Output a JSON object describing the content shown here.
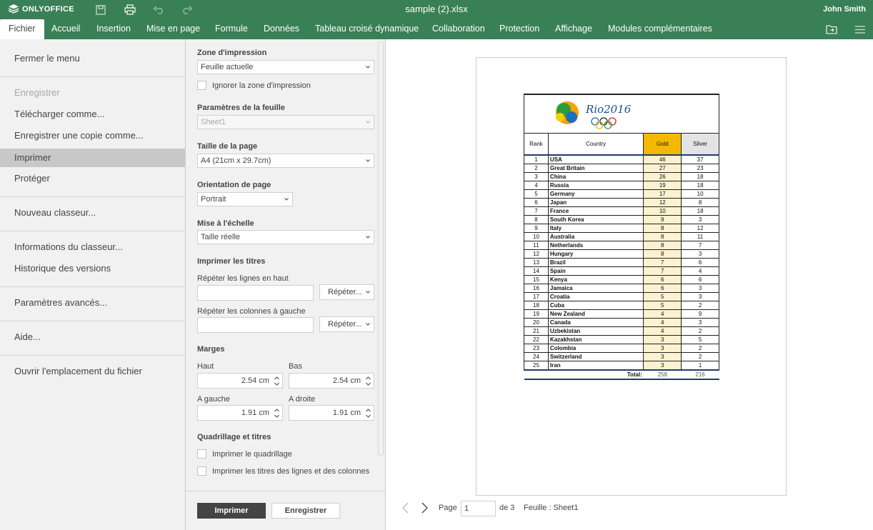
{
  "app": {
    "brand": "ONLYOFFICE",
    "document_title": "sample (2).xlsx",
    "user": "John Smith"
  },
  "tabs": [
    {
      "label": "Fichier",
      "active": true
    },
    {
      "label": "Accueil"
    },
    {
      "label": "Insertion"
    },
    {
      "label": "Mise en page"
    },
    {
      "label": "Formule"
    },
    {
      "label": "Données"
    },
    {
      "label": "Tableau croisé dynamique"
    },
    {
      "label": "Collaboration"
    },
    {
      "label": "Protection"
    },
    {
      "label": "Affichage"
    },
    {
      "label": "Modules complémentaires"
    }
  ],
  "file_menu": {
    "close": "Fermer le menu",
    "save": "Enregistrer",
    "download_as": "Télécharger comme...",
    "save_copy_as": "Enregistrer une copie comme...",
    "print": "Imprimer",
    "protect": "Protéger",
    "new": "Nouveau classeur...",
    "info": "Informations du classeur...",
    "history": "Historique des versions",
    "advanced": "Paramètres avancés...",
    "help": "Aide...",
    "open_location": "Ouvrir l'emplacement du fichier"
  },
  "print_settings": {
    "range_label": "Zone d'impression",
    "range_value": "Feuille actuelle",
    "ignore_range": "Ignorer la zone d'impression",
    "sheet_params_label": "Paramètres de la feuille",
    "sheet_value": "Sheet1",
    "page_size_label": "Taille de la page",
    "page_size_value": "A4 (21cm x 29.7cm)",
    "orientation_label": "Orientation de page",
    "orientation_value": "Portrait",
    "scaling_label": "Mise à l'échelle",
    "scaling_value": "Taille réelle",
    "print_titles_label": "Imprimer les titres",
    "repeat_rows_label": "Répéter les lignes en haut",
    "repeat_cols_label": "Répéter les colonnes à gauche",
    "repeat_button": "Répéter...",
    "margins_label": "Marges",
    "top_label": "Haut",
    "top_value": "2.54 cm",
    "bottom_label": "Bas",
    "bottom_value": "2.54 cm",
    "left_label": "A gauche",
    "left_value": "1.91 cm",
    "right_label": "A droite",
    "right_value": "1.91 cm",
    "grid_titles_label": "Quadrillage et titres",
    "print_grid": "Imprimer le quadrillage",
    "print_headings": "Imprimer les titres des lignes et des colonnes",
    "print_button": "Imprimer",
    "save_button": "Enregistrer"
  },
  "pager": {
    "page_label": "Page",
    "page_value": "1",
    "of_label": "de 3",
    "sheet_label": "Feuille : Sheet1"
  },
  "medal_table": {
    "logo_text": "Rio2016",
    "headers": [
      "Rank",
      "Country",
      "Gold",
      "Silver"
    ],
    "rows": [
      [
        "1",
        "USA",
        "46",
        "37"
      ],
      [
        "2",
        "Great Britain",
        "27",
        "23"
      ],
      [
        "3",
        "China",
        "26",
        "18"
      ],
      [
        "4",
        "Russia",
        "19",
        "18"
      ],
      [
        "5",
        "Germany",
        "17",
        "10"
      ],
      [
        "6",
        "Japan",
        "12",
        "8"
      ],
      [
        "7",
        "France",
        "10",
        "18"
      ],
      [
        "8",
        "South Korea",
        "9",
        "3"
      ],
      [
        "9",
        "Italy",
        "8",
        "12"
      ],
      [
        "10",
        "Australia",
        "8",
        "11"
      ],
      [
        "11",
        "Netherlands",
        "8",
        "7"
      ],
      [
        "12",
        "Hungary",
        "8",
        "3"
      ],
      [
        "13",
        "Brazil",
        "7",
        "6"
      ],
      [
        "14",
        "Spain",
        "7",
        "4"
      ],
      [
        "15",
        "Kenya",
        "6",
        "6"
      ],
      [
        "16",
        "Jamaica",
        "6",
        "3"
      ],
      [
        "17",
        "Croatia",
        "5",
        "3"
      ],
      [
        "18",
        "Cuba",
        "5",
        "2"
      ],
      [
        "19",
        "New Zealand",
        "4",
        "9"
      ],
      [
        "20",
        "Canada",
        "4",
        "3"
      ],
      [
        "21",
        "Uzbekistan",
        "4",
        "2"
      ],
      [
        "22",
        "Kazakhstan",
        "3",
        "5"
      ],
      [
        "23",
        "Colombia",
        "3",
        "2"
      ],
      [
        "24",
        "Switzerland",
        "3",
        "2"
      ],
      [
        "25",
        "Iran",
        "3",
        "1"
      ]
    ],
    "total_label": "Total:",
    "total_gold": "258",
    "total_silver": "216"
  },
  "colors": {
    "brand_green": "#3a8056",
    "gold_header": "#f5b800",
    "gold_cell": "#fdf2d0"
  }
}
